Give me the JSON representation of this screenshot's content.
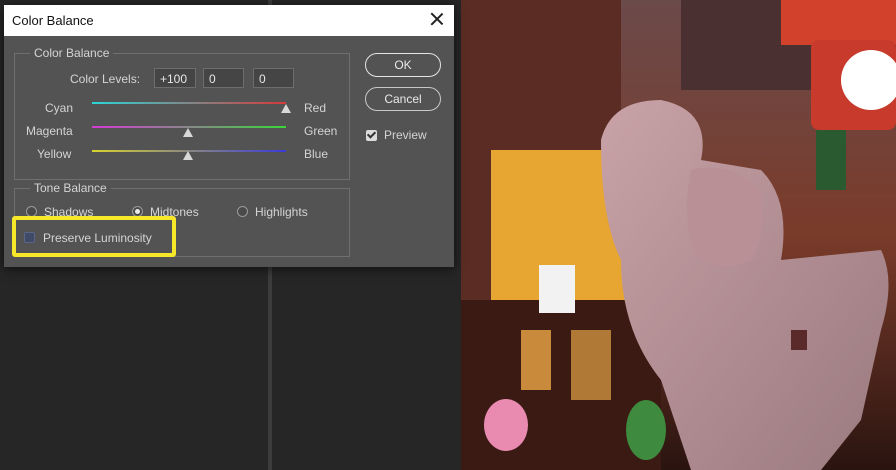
{
  "dialog": {
    "title": "Color Balance",
    "color_balance_group": "Color Balance",
    "color_levels_label": "Color Levels:",
    "color_levels": [
      "+100",
      "0",
      "0"
    ],
    "sliders": [
      {
        "left": "Cyan",
        "right": "Red",
        "value": 100
      },
      {
        "left": "Magenta",
        "right": "Green",
        "value": 0
      },
      {
        "left": "Yellow",
        "right": "Blue",
        "value": 0
      }
    ],
    "tone_balance_group": "Tone Balance",
    "tones": [
      "Shadows",
      "Midtones",
      "Highlights"
    ],
    "selected_tone": "Midtones",
    "preserve_luminosity": {
      "label": "Preserve Luminosity",
      "checked": false
    },
    "ok_label": "OK",
    "cancel_label": "Cancel",
    "preview": {
      "label": "Preview",
      "checked": true
    }
  },
  "colors": {
    "highlight": "#f7e82a",
    "dialog_bg": "#535353"
  }
}
